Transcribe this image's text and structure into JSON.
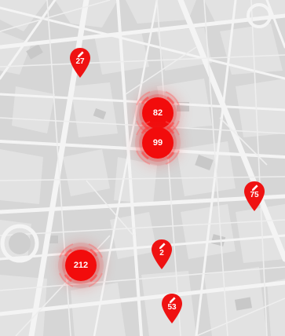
{
  "map": {
    "background_color": "#d9d9d9",
    "road_color": "#f4f4f4",
    "block_color": "#cfcfcf",
    "marker_color": "#f20c0c"
  },
  "clusters": [
    {
      "id": "cluster-212",
      "label": "212"
    },
    {
      "id": "cluster-82",
      "label": "82"
    },
    {
      "id": "cluster-99",
      "label": "99"
    }
  ],
  "pins": [
    {
      "id": "pin-27",
      "label": "27",
      "icon": "pencil-icon"
    },
    {
      "id": "pin-75",
      "label": "75",
      "icon": "pencil-icon"
    },
    {
      "id": "pin-2",
      "label": "2",
      "icon": "pencil-icon"
    },
    {
      "id": "pin-53",
      "label": "53",
      "icon": "pencil-icon"
    }
  ]
}
